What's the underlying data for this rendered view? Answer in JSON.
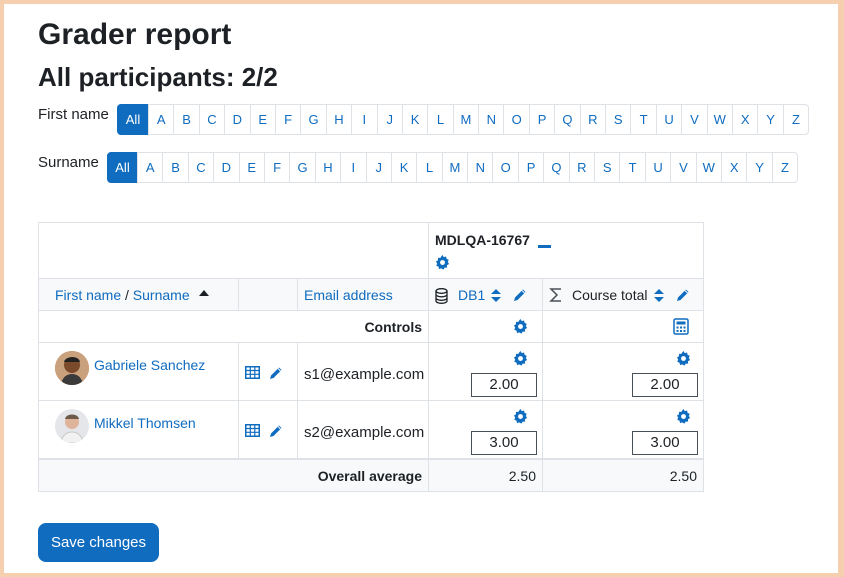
{
  "page": {
    "title": "Grader report",
    "participants": "All participants: 2/2"
  },
  "filters": {
    "first_name_label": "First name",
    "surname_label": "Surname",
    "letters": [
      "All",
      "A",
      "B",
      "C",
      "D",
      "E",
      "F",
      "G",
      "H",
      "I",
      "J",
      "K",
      "L",
      "M",
      "N",
      "O",
      "P",
      "Q",
      "R",
      "S",
      "T",
      "U",
      "V",
      "W",
      "X",
      "Y",
      "Z"
    ],
    "first_name_selected": "All",
    "surname_selected": "All"
  },
  "table": {
    "category_name": "MDLQA-16767",
    "col_first_name": "First name",
    "col_separator": " / ",
    "col_surname": "Surname",
    "col_email": "Email address",
    "col_db1": "DB1",
    "col_course_total": "Course total",
    "controls_label": "Controls",
    "overall_average_label": "Overall average",
    "overall_average_db1": "2.50",
    "overall_average_total": "2.50",
    "rows": [
      {
        "name": "Gabriele Sanchez",
        "email": "s1@example.com",
        "db1": "2.00",
        "total": "2.00"
      },
      {
        "name": "Mikkel Thomsen",
        "email": "s2@example.com",
        "db1": "3.00",
        "total": "3.00"
      }
    ]
  },
  "actions": {
    "save_label": "Save changes"
  },
  "colors": {
    "accent": "#0f6cbf",
    "page_border": "#f5cfae"
  },
  "icons": [
    "sort-ascending-icon",
    "collapse-icon",
    "gear-icon",
    "database-icon",
    "sort-toggle-icon",
    "pencil-icon",
    "sigma-icon",
    "calculator-icon",
    "grid-table-icon"
  ]
}
